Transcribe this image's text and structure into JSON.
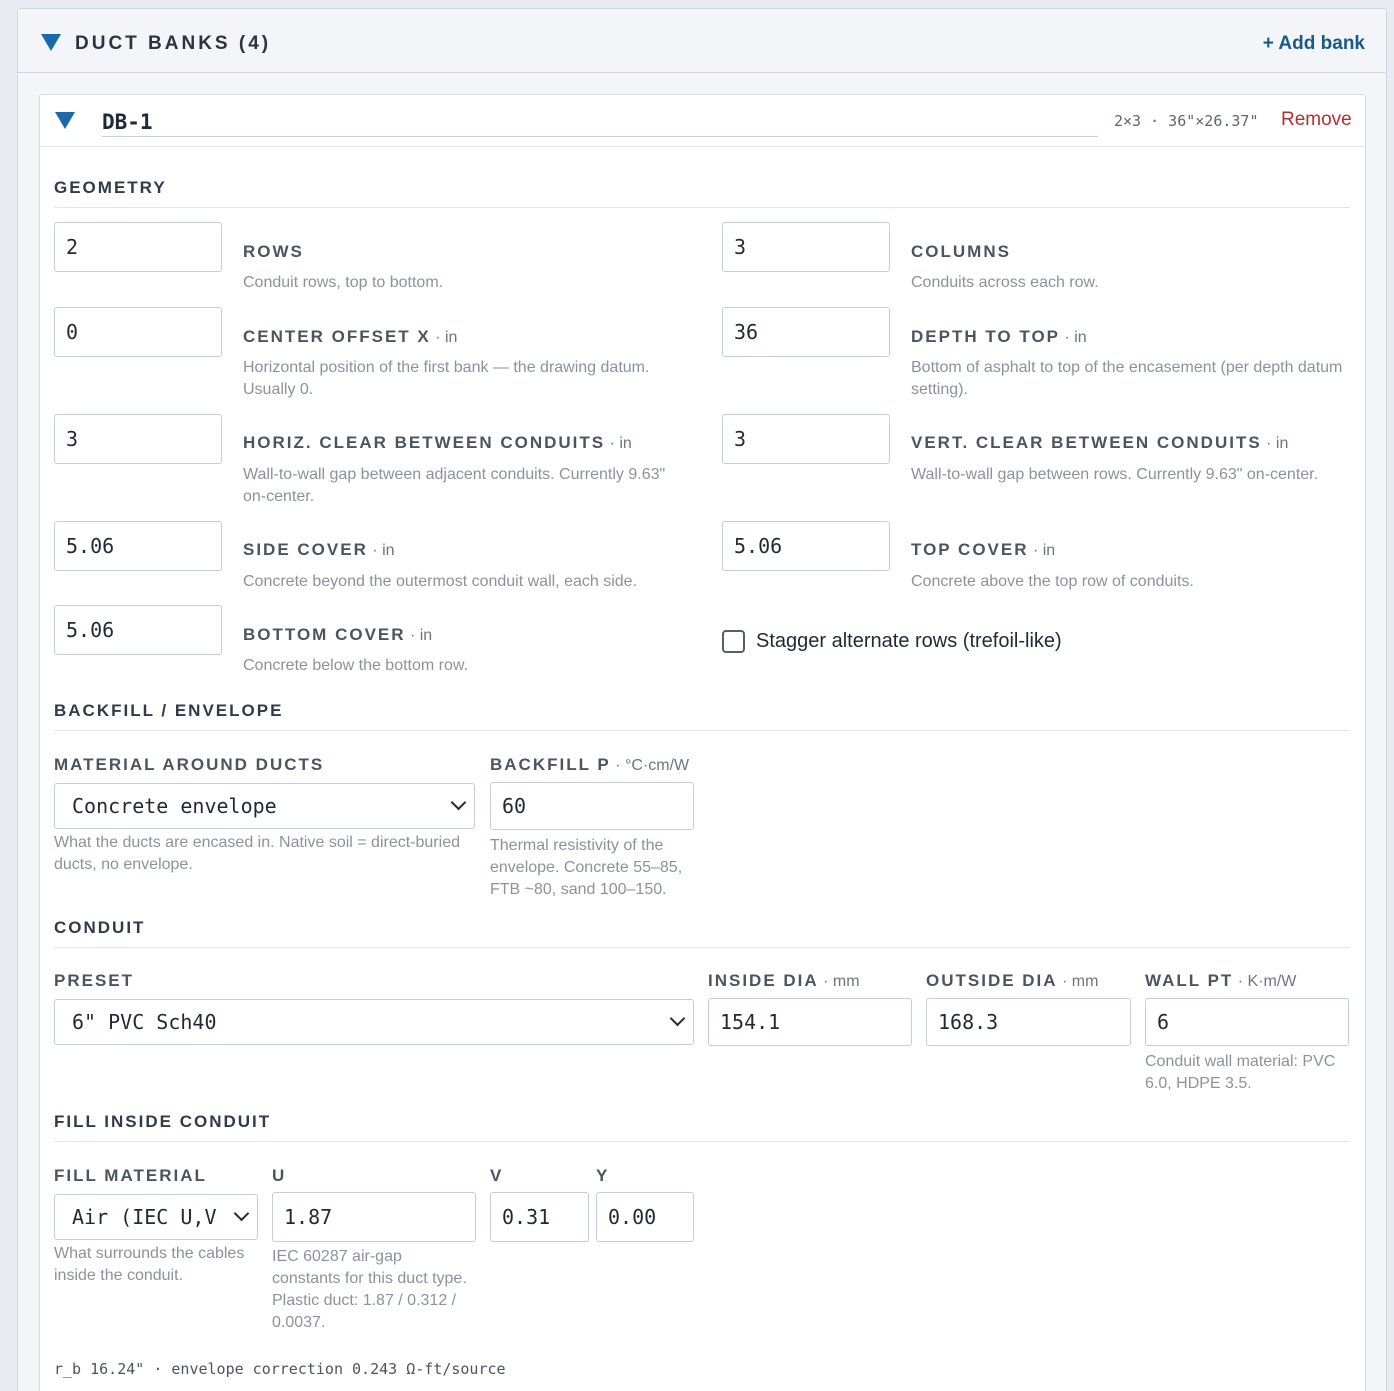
{
  "panel": {
    "title": "DUCT BANKS (4)",
    "add_label": "+ Add bank"
  },
  "bank": {
    "name": "DB-1",
    "meta": "2×3 · 36\"×26.37\"",
    "remove_label": "Remove"
  },
  "geometry": {
    "heading": "GEOMETRY",
    "rows": {
      "value": "2",
      "label": "ROWS",
      "unit": "",
      "help": "Conduit rows, top to bottom."
    },
    "columns": {
      "value": "3",
      "label": "COLUMNS",
      "unit": "",
      "help": "Conduits across each row."
    },
    "center_offset": {
      "value": "0",
      "label": "CENTER OFFSET X",
      "unit": " · in",
      "help": "Horizontal position of the first bank — the drawing datum. Usually 0."
    },
    "depth_to_top": {
      "value": "36",
      "label": "DEPTH TO TOP",
      "unit": " · in",
      "help": "Bottom of asphalt to top of the encasement (per depth datum setting)."
    },
    "horiz_clear": {
      "value": "3",
      "label": "HORIZ. CLEAR BETWEEN CONDUITS",
      "unit": " · in",
      "help": "Wall-to-wall gap between adjacent conduits. Currently 9.63\" on-center."
    },
    "vert_clear": {
      "value": "3",
      "label": "VERT. CLEAR BETWEEN CONDUITS",
      "unit": " · in",
      "help": "Wall-to-wall gap between rows. Currently 9.63\" on-center."
    },
    "side_cover": {
      "value": "5.06",
      "label": "SIDE COVER",
      "unit": " · in",
      "help": "Concrete beyond the outermost conduit wall, each side."
    },
    "top_cover": {
      "value": "5.06",
      "label": "TOP COVER",
      "unit": " · in",
      "help": "Concrete above the top row of conduits."
    },
    "bottom_cover": {
      "value": "5.06",
      "label": "BOTTOM COVER",
      "unit": " · in",
      "help": "Concrete below the bottom row."
    },
    "stagger": {
      "label": "Stagger alternate rows (trefoil-like)",
      "checked": false
    }
  },
  "backfill": {
    "heading": "BACKFILL / ENVELOPE",
    "material": {
      "label": "MATERIAL AROUND DUCTS",
      "value": "Concrete envelope",
      "help": "What the ducts are encased in. Native soil = direct-buried ducts, no envelope."
    },
    "rho": {
      "label": "BACKFILL Ρ",
      "unit": " · °C·cm/W",
      "value": "60",
      "help": "Thermal resistivity of the envelope. Concrete 55–85, FTB ~80, sand 100–150."
    }
  },
  "conduit": {
    "heading": "CONDUIT",
    "preset": {
      "label": "PRESET",
      "value": "6\" PVC Sch40"
    },
    "inside_dia": {
      "label": "INSIDE DIA",
      "unit": " · mm",
      "value": "154.1"
    },
    "outside_dia": {
      "label": "OUTSIDE DIA",
      "unit": " · mm",
      "value": "168.3"
    },
    "wall_pt": {
      "label": "WALL PT",
      "unit": " · K·m/W",
      "value": "6",
      "help": "Conduit wall material: PVC 6.0, HDPE 3.5."
    }
  },
  "fill": {
    "heading": "FILL INSIDE CONDUIT",
    "material": {
      "label": "FILL MATERIAL",
      "value": "Air (IEC U,V",
      "help": "What surrounds the cables inside the conduit."
    },
    "u": {
      "label": "U",
      "value": "1.87",
      "help": "IEC 60287 air-gap constants for this duct type. Plastic duct: 1.87 / 0.312 / 0.0037."
    },
    "v": {
      "label": "V",
      "value": "0.31"
    },
    "y": {
      "label": "Y",
      "value": "0.00"
    }
  },
  "footer": "r_b 16.24\" · envelope correction 0.243 Ω-ft/source"
}
